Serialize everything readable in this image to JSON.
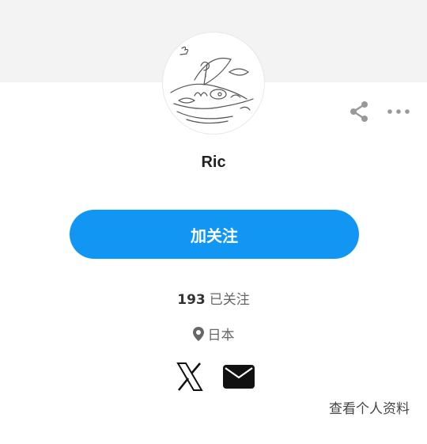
{
  "profile": {
    "username": "Ric",
    "follow_label": "加关注",
    "following_count": "193",
    "following_label": "已关注",
    "location": "日本",
    "view_profile_label": "查看个人资料"
  },
  "icons": {
    "share": "share-icon",
    "more": "more-icon",
    "location": "location-pin-icon",
    "x": "x-logo-icon",
    "mail": "mail-icon"
  },
  "colors": {
    "accent": "#1196f3",
    "cover": "#f3f3f3",
    "icon": "#999999",
    "social": "#111111"
  }
}
